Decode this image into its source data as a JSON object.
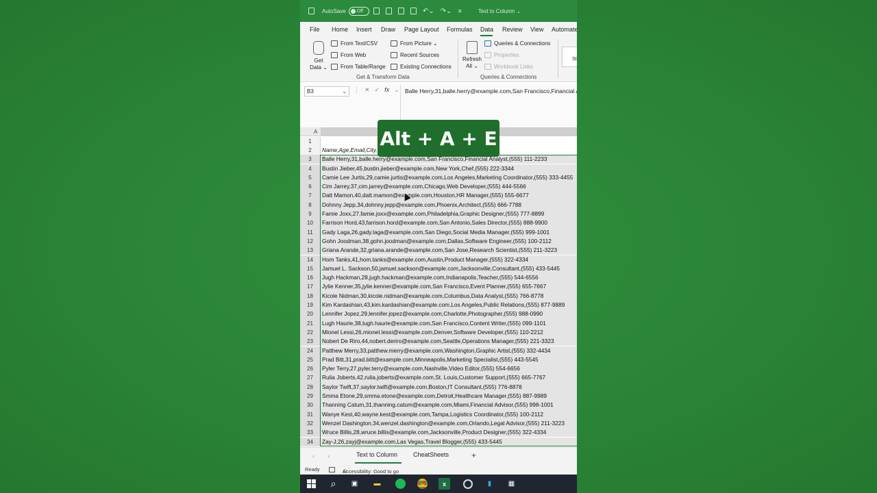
{
  "titlebar": {
    "autosave_label": "AutoSave",
    "autosave_state": "Off",
    "doc_title": "Text to Column ⌄"
  },
  "menu": {
    "tabs": [
      "File",
      "Home",
      "Insert",
      "Draw",
      "Page Layout",
      "Formulas",
      "Data",
      "Review",
      "View",
      "Automate"
    ],
    "active": "Data"
  },
  "ribbon": {
    "get_data": "Get Data",
    "get_data_line1": "Get",
    "get_data_line2": "Data ⌄",
    "from_text_csv": "From Text/CSV",
    "from_web": "From Web",
    "from_table_range": "From Table/Range",
    "from_picture": "From Picture ⌄",
    "recent_sources": "Recent Sources",
    "existing_connections": "Existing Connections",
    "group1_label": "Get & Transform Data",
    "refresh_line1": "Refresh",
    "refresh_line2": "All ⌄",
    "queries_connections": "Queries & Connections",
    "properties": "Properties",
    "workbook_links": "Workbook Links",
    "group2_label": "Queries & Connections",
    "st_fragment": "St"
  },
  "formula_bar": {
    "name_box": "B3",
    "content": "Balle Herry,31,balle.herry@example.com,San Francisco,Financial Analyst,(555) 111-2233"
  },
  "grid": {
    "col_a": "A",
    "rows": [
      {
        "num": "1",
        "text": ""
      },
      {
        "num": "2",
        "text": "Name,Age,Email,City,Occupation,Phone"
      },
      {
        "num": "3",
        "text": "Balle Herry,31,balle.herry@example.com,San Francisco,Financial Analyst,(555) 111-2233"
      },
      {
        "num": "4",
        "text": "Bustin Jieber,45,bustin.jieber@example.com,New York,Chef,(555) 222-3344"
      },
      {
        "num": "5",
        "text": "Camie Lee Jurtis,29,camie.jurtis@example.com,Los Angeles,Marketing Coordinator,(555) 333-4455"
      },
      {
        "num": "6",
        "text": "Cim Jarrey,37,cim.jarrey@example.com,Chicago,Web Developer,(555) 444-5566"
      },
      {
        "num": "7",
        "text": "Datt Mamon,40,datt.mamon@example.com,Houston,HR Manager,(555) 555-6677"
      },
      {
        "num": "8",
        "text": "Dohnny Jepp,34,dohnny.jepp@example.com,Phoenix,Architect,(555) 666-7788"
      },
      {
        "num": "9",
        "text": "Famie Joxx,27,famie.joxx@example.com,Philadelphia,Graphic Designer,(555) 777-8899"
      },
      {
        "num": "10",
        "text": "Farrison Hord,43,farrison.hord@example.com,San Antonio,Sales Director,(555) 888-9900"
      },
      {
        "num": "11",
        "text": "Gady Laga,26,gady.laga@example.com,San Diego,Social Media Manager,(555) 999-1001"
      },
      {
        "num": "12",
        "text": "Gohn Joodman,38,gohn.joodman@example.com,Dallas,Software Engineer,(555) 100-2112"
      },
      {
        "num": "13",
        "text": "Griana Arande,32,griana.arande@example.com,San Jose,Research Scientist,(555) 211-3223"
      },
      {
        "num": "14",
        "text": "Hom Tanks,41,hom.tanks@example.com,Austin,Product Manager,(555) 322-4334"
      },
      {
        "num": "15",
        "text": "Jamuel L. Sackson,50,jamuel.sackson@example.com,Jacksonville,Consultant,(555) 433-5445"
      },
      {
        "num": "16",
        "text": "Jugh Hackman,28,jugh.hackman@example.com,Indianapolis,Teacher,(555) 544-6556"
      },
      {
        "num": "17",
        "text": "Jylie Kenner,35,jylie.kenner@example.com,San Francisco,Event Planner,(555) 655-7667"
      },
      {
        "num": "18",
        "text": "Kicole Nidman,30,kicole.nidman@example.com,Columbus,Data Analyst,(555) 766-8778"
      },
      {
        "num": "19",
        "text": "Kim Kardashian,43,kim.kardashian@example.com,Los Angeles,Public Relations,(555) 877-9889"
      },
      {
        "num": "20",
        "text": "Lennifer Jopez,29,lennifer.jopez@example.com,Charlotte,Photographer,(555) 988-0990"
      },
      {
        "num": "21",
        "text": "Lugh Haurie,38,lugh.haurie@example.com,San Francisco,Content Writer,(555) 099-1101"
      },
      {
        "num": "22",
        "text": "Mionel Lessi,26,mionel.lessi@example.com,Denver,Software Developer,(555) 110-2212"
      },
      {
        "num": "23",
        "text": "Nobert De Riro,44,nobert.deriro@example.com,Seattle,Operations Manager,(555) 221-3323"
      },
      {
        "num": "24",
        "text": "Patthew Merry,33,patthew.merry@example.com,Washington,Graphic Artist,(555) 332-4434"
      },
      {
        "num": "25",
        "text": "Prad Bitt,31,prad.bitt@example.com,Minneapolis,Marketing Specialist,(555) 443-5545"
      },
      {
        "num": "26",
        "text": "Pyler Terry,27,pyler.terry@example.com,Nashville,Video Editor,(555) 554-6656"
      },
      {
        "num": "27",
        "text": "Rulia Joberts,42,rulia.joberts@example.com,St. Louis,Customer Support,(555) 665-7767"
      },
      {
        "num": "28",
        "text": "Saylor Twift,37,saylor.twift@example.com,Boston,IT Consultant,(555) 776-8878"
      },
      {
        "num": "29",
        "text": "Smma Etone,29,smma.etone@example.com,Detroit,Healthcare Manager,(555) 887-9989"
      },
      {
        "num": "30",
        "text": "Thanning Catum,31,thanning.catum@example.com,Miami,Financial Advisor,(555) 998-1001"
      },
      {
        "num": "31",
        "text": "Wanye Kest,40,wayne.kest@example.com,Tampa,Logistics Coordinator,(555) 100-2112"
      },
      {
        "num": "32",
        "text": "Wenzel Dashington,34,wenzel.dashington@example.com,Orlando,Legal Advisor,(555) 211-3223"
      },
      {
        "num": "33",
        "text": "Wruce Billis,28,wruce.billis@example.com,Jacksonville,Product Designer,(555) 322-4334"
      },
      {
        "num": "34",
        "text": "Zay-J,26,zayj@example.com,Las Vegas,Travel Blogger,(555) 433-5445"
      }
    ]
  },
  "overlay": {
    "shortcut": "Alt + A + E"
  },
  "sheets": {
    "tabs": [
      "Text to Column",
      "CheatSheets"
    ],
    "active": "Text to Column",
    "add": "+"
  },
  "status": {
    "ready": "Ready",
    "accessibility": "Accessibility: Good to go"
  },
  "colors": {
    "excel_green": "#2b8a3e",
    "accent": "#1e7d3a",
    "overlay_bg": "#1f6e2c",
    "taskbar": "#1f2630"
  }
}
